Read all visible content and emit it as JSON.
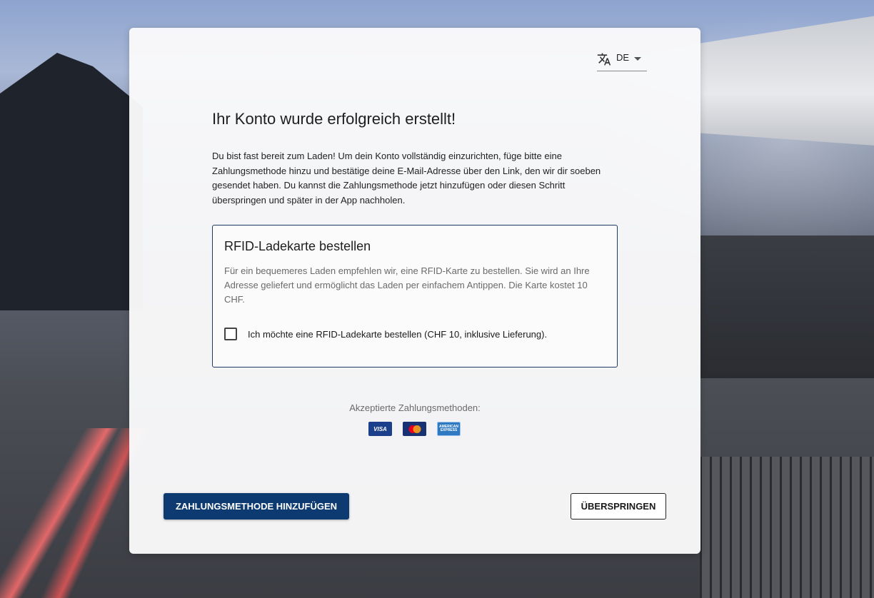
{
  "language": {
    "code": "DE",
    "icon": "translate-icon"
  },
  "header": {
    "title": "Ihr Konto wurde erfolgreich erstellt!"
  },
  "intro": {
    "text": "Du bist fast bereit zum Laden! Um dein Konto vollständig einzurichten, füge bitte eine Zahlungsmethode hinzu und bestätige deine E-Mail-Adresse über den Link, den wir dir soeben gesendet haben. Du kannst die Zahlungsmethode jetzt hinzufügen oder diesen Schritt überspringen und später in der App nachholen."
  },
  "rfid": {
    "title": "RFID-Ladekarte bestellen",
    "description": "Für ein bequemeres Laden empfehlen wir, eine RFID-Karte zu bestellen. Sie wird an Ihre Adresse geliefert und ermöglicht das Laden per einfachem Antippen. Die Karte kostet 10 CHF.",
    "checkbox_label": "Ich möchte eine RFID-Ladekarte bestellen (CHF 10, inklusive Lieferung).",
    "checked": false
  },
  "payments": {
    "label": "Akzeptierte Zahlungsmethoden:",
    "methods": [
      {
        "name": "visa-icon",
        "text": "VISA"
      },
      {
        "name": "mastercard-icon"
      },
      {
        "name": "amex-icon",
        "text": "AMERICAN EXPRESS"
      }
    ]
  },
  "actions": {
    "primary_label": "ZAHLUNGSMETHODE HINZUFÜGEN",
    "secondary_label": "ÜBERSPRINGEN"
  },
  "colors": {
    "primary": "#0c3a71",
    "box_border": "#1d3a64"
  }
}
